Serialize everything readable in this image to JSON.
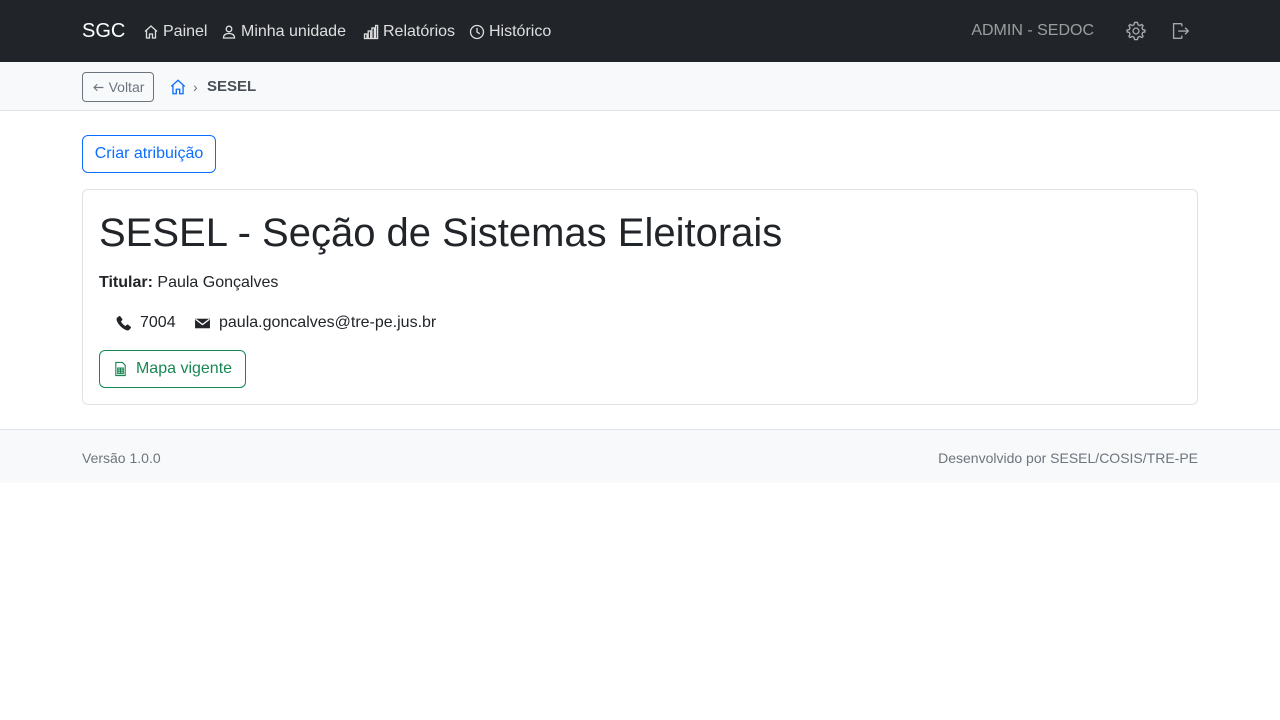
{
  "navbar": {
    "brand": "SGC",
    "items": [
      {
        "label": "Painel",
        "icon": "house-icon"
      },
      {
        "label": "Minha unidade",
        "icon": "person-icon"
      },
      {
        "label": "Relatórios",
        "icon": "bar-chart-icon"
      },
      {
        "label": "Histórico",
        "icon": "clock-icon"
      }
    ],
    "user": "ADMIN - SEDOC",
    "settings_icon": "gear-icon",
    "logout_icon": "logout-icon"
  },
  "breadcrumb": {
    "back_label": "Voltar",
    "separator": "›",
    "current": "SESEL"
  },
  "main": {
    "create_button": "Criar atribuição",
    "unit_title": "SESEL - Seção de Sistemas Eleitorais",
    "titular_label": "Titular:",
    "titular_name": "Paula Gonçalves",
    "phone": "7004",
    "email": "paula.goncalves@tre-pe.jus.br",
    "mapa_button": "Mapa vigente"
  },
  "footer": {
    "version": "Versão 1.0.0",
    "developer": "Desenvolvido por SESEL/COSIS/TRE-PE"
  },
  "colors": {
    "navbar_bg": "#212529",
    "primary": "#0d6efd",
    "success": "#198754",
    "secondary": "#6c757d"
  }
}
